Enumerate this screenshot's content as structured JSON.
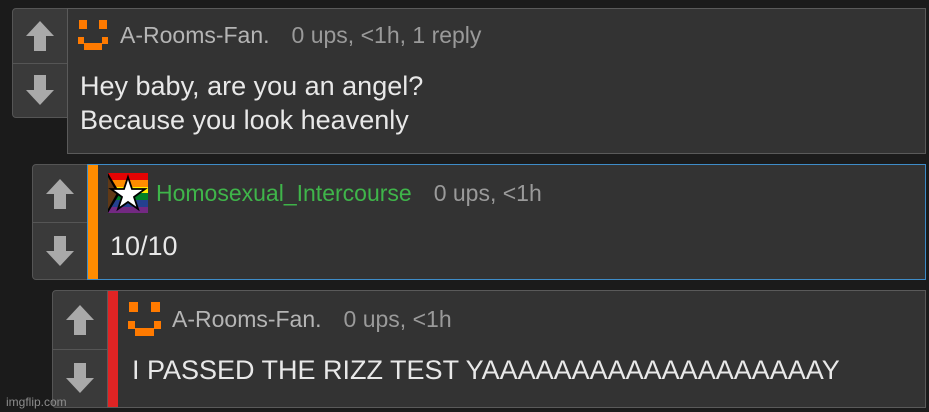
{
  "colors": {
    "background": "#1b1b1b",
    "card": "#333333",
    "username_default": "#b5b5b5",
    "username_green": "#3fb54a",
    "accent_orange": "#ff8c00",
    "accent_red": "#e02424",
    "accent_blue": "#2a8fd4",
    "avatar_orange": "#ff7a00"
  },
  "comments": [
    {
      "username": "A-Rooms-Fan.",
      "stats": "0 ups, <1h, 1 reply",
      "body_lines": [
        "Hey baby, are you an angel?",
        "Because you look heavenly"
      ],
      "avatar_icon": "smiley-face-icon"
    },
    {
      "username": "Homosexual_Intercourse",
      "stats": "0 ups, <1h",
      "body_lines": [
        "10/10"
      ],
      "avatar_icon": "rainbow-star-flag-icon"
    },
    {
      "username": "A-Rooms-Fan.",
      "stats": "0 ups, <1h",
      "body_lines": [
        "I PASSED THE RIZZ TEST YAAAAAAAAAAAAAAAAAAAY"
      ],
      "avatar_icon": "smiley-face-icon"
    }
  ],
  "icons": {
    "upvote": "arrow-up-icon",
    "downvote": "arrow-down-icon"
  },
  "watermark": "imgflip.com"
}
